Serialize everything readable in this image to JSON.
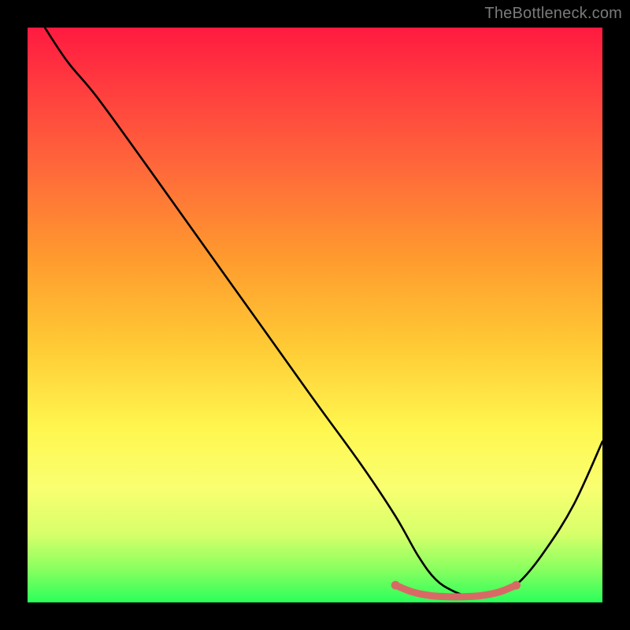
{
  "watermark": "TheBottleneck.com",
  "chart_data": {
    "type": "line",
    "title": "",
    "xlabel": "",
    "ylabel": "",
    "xlim": [
      0,
      100
    ],
    "ylim": [
      0,
      100
    ],
    "series": [
      {
        "name": "bottleneck-curve",
        "color": "#000000",
        "x": [
          3,
          7,
          12,
          20,
          30,
          40,
          50,
          58,
          64,
          68,
          71,
          74,
          77,
          80,
          83,
          86,
          90,
          95,
          100
        ],
        "values": [
          100,
          94,
          88,
          77,
          63,
          49,
          35,
          24,
          15,
          8,
          4,
          2,
          1,
          1,
          2,
          4,
          9,
          17,
          28
        ]
      },
      {
        "name": "optimal-band",
        "color": "#d86a66",
        "x": [
          64,
          67,
          70,
          73,
          76,
          79,
          82,
          85
        ],
        "values": [
          3.0,
          1.8,
          1.2,
          1.0,
          1.0,
          1.2,
          1.8,
          3.0
        ]
      }
    ],
    "gradient_stops": [
      {
        "pos": 0,
        "color": "#ff1a40"
      },
      {
        "pos": 10,
        "color": "#ff3b3f"
      },
      {
        "pos": 25,
        "color": "#ff6a3a"
      },
      {
        "pos": 40,
        "color": "#ff9a2e"
      },
      {
        "pos": 55,
        "color": "#ffc934"
      },
      {
        "pos": 70,
        "color": "#fff750"
      },
      {
        "pos": 80,
        "color": "#f9ff70"
      },
      {
        "pos": 88,
        "color": "#d8ff6a"
      },
      {
        "pos": 94,
        "color": "#8cff60"
      },
      {
        "pos": 100,
        "color": "#2bff5a"
      }
    ]
  }
}
